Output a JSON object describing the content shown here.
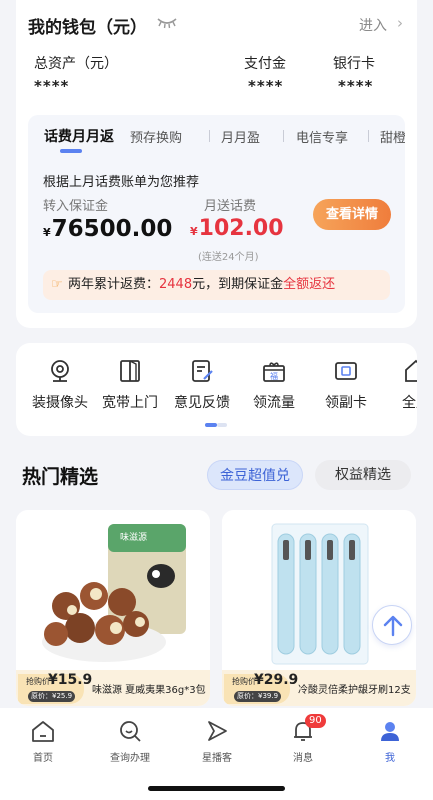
{
  "wallet": {
    "title": "我的钱包（元）",
    "enter_label": "进入",
    "assets": [
      {
        "label": "总资产（元）",
        "value": "****"
      },
      {
        "label": "支付金",
        "value": "****"
      },
      {
        "label": "银行卡",
        "value": "****"
      }
    ]
  },
  "bill": {
    "tabs": [
      "话费月月返",
      "预存换购",
      "月月盈",
      "电信专享",
      "甜橙"
    ],
    "recommend_text": "根据上月话费账单为您推荐",
    "deposit_label": "转入保证金",
    "deposit_currency": "¥",
    "deposit_value": "76500.00",
    "gift_label": "月送话费",
    "gift_currency": "¥",
    "gift_value": "102.00",
    "gift_note": "(连送24个月)",
    "detail_button": "查看详情",
    "refund_prefix": "两年累计返费：",
    "refund_amount": "2448",
    "refund_mid": "元，到期保证金",
    "refund_emph": "全额返还"
  },
  "services": [
    {
      "label": "装摄像头",
      "icon": "camera-icon"
    },
    {
      "label": "宽带上门",
      "icon": "door-icon"
    },
    {
      "label": "意见反馈",
      "icon": "feedback-icon"
    },
    {
      "label": "领流量",
      "icon": "gift-box-icon"
    },
    {
      "label": "领副卡",
      "icon": "sim-card-icon"
    },
    {
      "label": "全屋",
      "icon": "house-icon"
    }
  ],
  "hot": {
    "title": "热门精选",
    "chips": [
      "金豆超值兑",
      "权益精选"
    ]
  },
  "products": [
    {
      "tag": "抢购价：",
      "price": "¥15.9",
      "orig": "原价：¥25.9",
      "name": "味滋源 夏威夷果36g*3包"
    },
    {
      "tag": "抢购价：",
      "price": "¥29.9",
      "orig": "原价：¥39.9",
      "name": "冷酸灵倍柔护龈牙刷12支"
    }
  ],
  "nav": [
    {
      "label": "首页",
      "icon": "home-icon"
    },
    {
      "label": "查询办理",
      "icon": "search-icon"
    },
    {
      "label": "星播客",
      "icon": "play-icon"
    },
    {
      "label": "消息",
      "icon": "bell-icon",
      "badge": "90"
    },
    {
      "label": "我",
      "icon": "person-icon"
    }
  ],
  "colors": {
    "accent": "#3d63d6",
    "price_red": "#e6343f",
    "orange": "#ef7d3c"
  }
}
